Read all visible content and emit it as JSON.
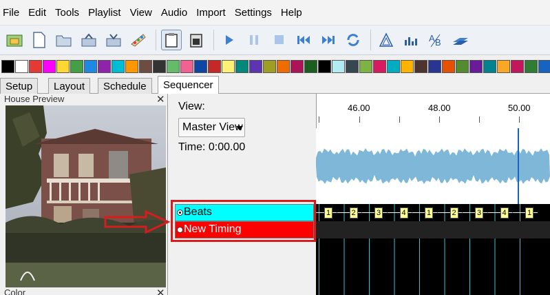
{
  "menu": [
    "File",
    "Edit",
    "Tools",
    "Playlist",
    "View",
    "Audio",
    "Import",
    "Settings",
    "Help"
  ],
  "toolbar": {
    "buttons": [
      "new-sequence",
      "new-file",
      "open-file",
      "save",
      "save-as",
      "render",
      "copy",
      "paste",
      "play",
      "pause",
      "stop",
      "rewind",
      "fast-forward",
      "loop",
      "effect-a",
      "bars",
      "text-ab",
      "layers"
    ]
  },
  "tabs": [
    "Setup",
    "Layout",
    "Schedule",
    "Sequencer"
  ],
  "active_tab": "Sequencer",
  "house_preview": {
    "title": "House Preview",
    "close": "✕"
  },
  "color_panel": {
    "title": "Color",
    "close": "✕"
  },
  "sequencer": {
    "view_label": "View:",
    "view_value": "Master View",
    "time_label": "Time: 0:00.00"
  },
  "timing_rows": [
    {
      "label": "Beats",
      "color": "#00ffff",
      "selected": true
    },
    {
      "label": "New Timing",
      "color": "#ff0000",
      "selected": false
    }
  ],
  "timeline": {
    "ruler": [
      "46.00",
      "48.00",
      "50.00"
    ],
    "beats": [
      "1",
      "2",
      "3",
      "4",
      "1",
      "2",
      "3",
      "4",
      "1"
    ]
  },
  "colors": {
    "highlight": "#d61c1c",
    "arrow": "#d61c1c"
  }
}
